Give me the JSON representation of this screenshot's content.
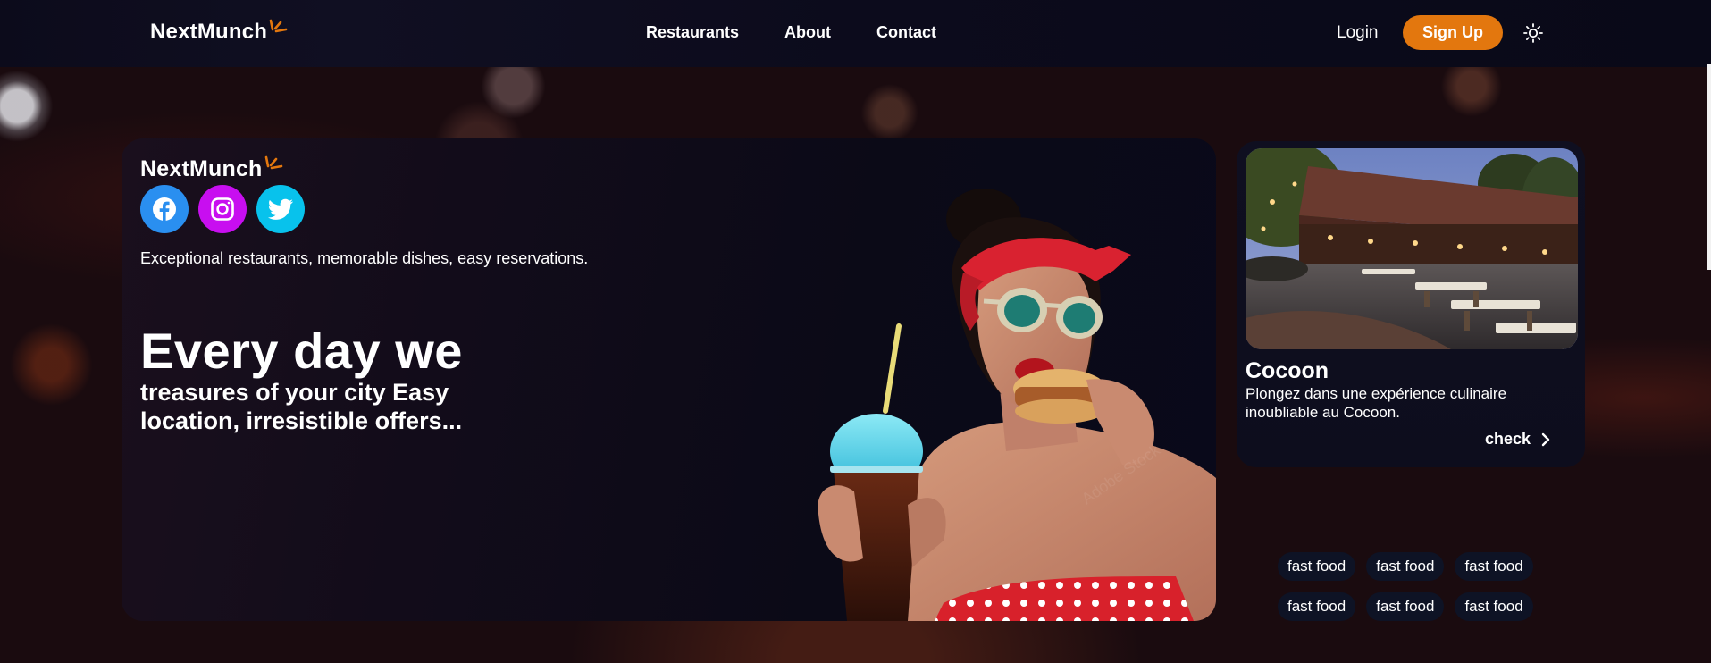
{
  "nav": {
    "brand": "NextMunch",
    "links": [
      "Restaurants",
      "About",
      "Contact"
    ],
    "login": "Login",
    "signup": "Sign Up",
    "theme_icon": "sun-icon"
  },
  "hero": {
    "brand": "NextMunch",
    "socials": [
      "facebook-icon",
      "instagram-icon",
      "twitter-icon"
    ],
    "tagline": "Exceptional restaurants, memorable dishes, easy reservations.",
    "headline": "Every day we",
    "subhead": "treasures of your city Easy location, irresistible offers...",
    "watermark": "Adobe Stock"
  },
  "restaurant": {
    "name": "Cocoon",
    "description": "Plongez dans une expérience culinaire inoubliable au Cocoon.",
    "action": "check"
  },
  "tags": [
    "fast food",
    "fast food",
    "fast food",
    "fast food",
    "fast food",
    "fast food"
  ],
  "colors": {
    "accent": "#e3770e",
    "facebook": "#2a8ff0",
    "instagram": "#c80ef0",
    "twitter": "#08c2ec",
    "tag_bg": "#0e1325"
  }
}
